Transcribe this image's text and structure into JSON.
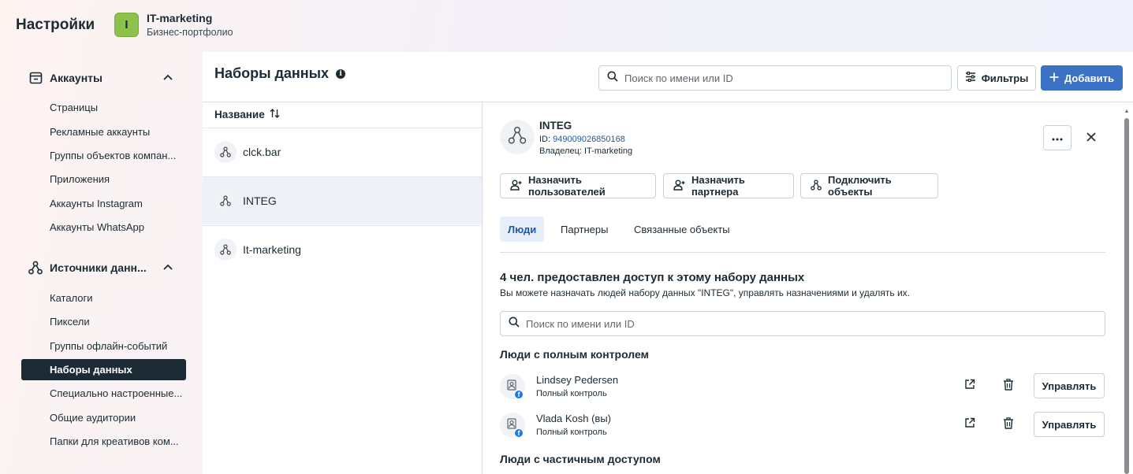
{
  "header": {
    "app_title": "Настройки",
    "business": {
      "avatar_letter": "I",
      "name": "IT-marketing",
      "subtitle": "Бизнес-портфолио"
    }
  },
  "sidebar": {
    "sections": [
      {
        "label": "Аккаунты",
        "icon": "account-card-icon",
        "items": [
          "Страницы",
          "Рекламные аккаунты",
          "Группы объектов компан...",
          "Приложения",
          "Аккаунты Instagram",
          "Аккаунты WhatsApp"
        ]
      },
      {
        "label": "Источники данн...",
        "icon": "data-sources-icon",
        "items": [
          "Каталоги",
          "Пиксели",
          "Группы офлайн-событий",
          "Наборы данных",
          "Специально настроенные...",
          "Общие аудитории",
          "Папки для креативов ком..."
        ]
      }
    ],
    "active_item": "Наборы данных"
  },
  "main": {
    "title": "Наборы данных",
    "search_placeholder": "Поиск по имени или ID",
    "filters_label": "Фильтры",
    "add_label": "Добавить",
    "list": {
      "column_header": "Название",
      "sort_icon": "sort-icon",
      "rows": [
        "clck.bar",
        "INTEG",
        "It-marketing"
      ],
      "selected": "INTEG"
    },
    "detail": {
      "name": "INTEG",
      "id_label": "ID:",
      "id_value": "949009026850168",
      "owner": "Владелец: IT-marketing",
      "actions": [
        "Назначить пользователей",
        "Назначить партнера",
        "Подключить объекты"
      ],
      "tabs": [
        "Люди",
        "Партнеры",
        "Связанные объекты"
      ],
      "active_tab": "Люди",
      "section_title": "4 чел. предоставлен доступ к этому набору данных",
      "section_subtitle": "Вы можете назначать людей набору данных \"INTEG\", управлять назначениями и удалять их.",
      "people_search_placeholder": "Поиск по имени или ID",
      "full_control_title": "Люди с полным контролем",
      "people": [
        {
          "name": "Lindsey Pedersen",
          "role": "Полный контроль",
          "manage_label": "Управлять"
        },
        {
          "name": "Vlada Kosh (вы)",
          "role": "Полный контроль",
          "manage_label": "Управлять"
        }
      ],
      "partial_access_title": "Люди с частичным доступом"
    }
  },
  "colors": {
    "primary": "#3b72c4",
    "link": "#1d5aa8",
    "active_sidebar": "#1c2b33",
    "business_avatar": "#8bc34a",
    "facebook": "#1877f2"
  }
}
